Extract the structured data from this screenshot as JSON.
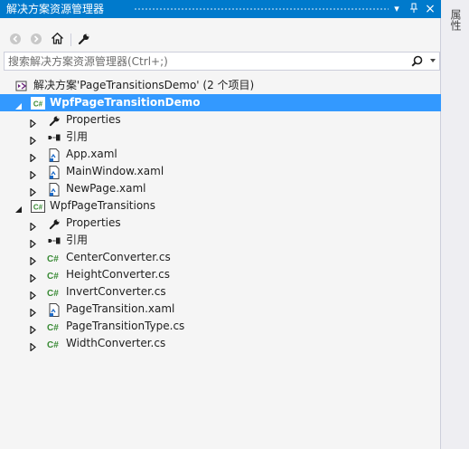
{
  "window": {
    "title": "解决方案资源管理器",
    "buttons": {
      "dropdown": "▾",
      "pin": "⊥",
      "close": "×"
    }
  },
  "toolbar": {
    "items": [
      "back-icon",
      "forward-icon",
      "home-icon",
      "properties-wrench-icon"
    ]
  },
  "search": {
    "placeholder": "搜索解决方案资源管理器(Ctrl+;)",
    "value": ""
  },
  "tree": {
    "solution": "解决方案'PageTransitionsDemo' (2 个项目)",
    "projects": [
      {
        "name": "WpfPageTransitionDemo",
        "selected": true,
        "expanded": true,
        "items": [
          {
            "label": "Properties",
            "icon": "wrench-icon"
          },
          {
            "label": "引用",
            "icon": "references-icon"
          },
          {
            "label": "App.xaml",
            "icon": "xaml-file-icon"
          },
          {
            "label": "MainWindow.xaml",
            "icon": "xaml-file-icon"
          },
          {
            "label": "NewPage.xaml",
            "icon": "xaml-file-icon"
          }
        ]
      },
      {
        "name": "WpfPageTransitions",
        "selected": false,
        "expanded": true,
        "items": [
          {
            "label": "Properties",
            "icon": "wrench-icon"
          },
          {
            "label": "引用",
            "icon": "references-icon"
          },
          {
            "label": "CenterConverter.cs",
            "icon": "csharp-file-icon"
          },
          {
            "label": "HeightConverter.cs",
            "icon": "csharp-file-icon"
          },
          {
            "label": "InvertConverter.cs",
            "icon": "csharp-file-icon"
          },
          {
            "label": "PageTransition.xaml",
            "icon": "xaml-file-icon"
          },
          {
            "label": "PageTransitionType.cs",
            "icon": "csharp-file-icon"
          },
          {
            "label": "WidthConverter.cs",
            "icon": "csharp-file-icon"
          }
        ]
      }
    ]
  },
  "side_tab": {
    "label": "属性"
  },
  "colors": {
    "accent": "#007acc",
    "selection": "#3399ff",
    "panel_bg": "#f5f5f5",
    "csharp_green": "#388a34"
  }
}
